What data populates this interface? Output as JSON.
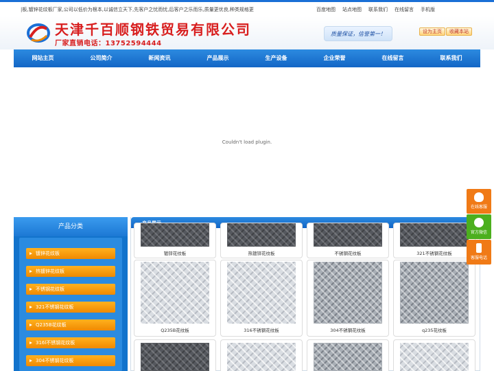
{
  "topbar": {
    "marquee": "|板,镀锌花纹板厂家,公司以低价为根本,以诚信立天下,先客户之忧而忧,后客户之乐而乐,质量更优良,种类规格更齐全,服务更周到",
    "links": [
      "百度地图",
      "站点地图",
      "联系我们",
      "在线留言",
      "手机版"
    ]
  },
  "header": {
    "company": "天津千百顺钢铁贸易有限公司",
    "hotline": "厂家直销电话：13752594444",
    "slogan": "质量保证，信誉第一！",
    "set_home": "设为主页",
    "bookmark": "收藏本站",
    "logo_colors": [
      "#1a6fd6",
      "#d81e1e",
      "#f08900"
    ]
  },
  "nav": [
    "网站主页",
    "公司简介",
    "新闻资讯",
    "产品展示",
    "生产设备",
    "企业荣誉",
    "在线留言",
    "联系我们"
  ],
  "banner": {
    "message": "Couldn't load plugin."
  },
  "sidebar": {
    "title": "产品分类",
    "categories": [
      "镀锌花纹板",
      "热镀锌花纹板",
      "不锈钢花纹板",
      "321不锈钢花纹板",
      "Q235B花纹板",
      "316l不锈钢花纹板",
      "304不锈钢花纹板"
    ]
  },
  "products": {
    "title": "产品展示",
    "items": [
      {
        "name": "镀锌花纹板",
        "texture": "dark"
      },
      {
        "name": "热镀锌花纹板",
        "texture": "dark"
      },
      {
        "name": "不锈钢花纹板",
        "texture": "dark"
      },
      {
        "name": "321不锈钢花纹板",
        "texture": "dark"
      },
      {
        "name": "Q235B花纹板",
        "texture": "light"
      },
      {
        "name": "316不锈钢花纹板",
        "texture": "light"
      },
      {
        "name": "304不锈钢花纹板",
        "texture": "mid"
      },
      {
        "name": "q235花纹板",
        "texture": "mid"
      },
      {
        "name": "",
        "texture": "dark"
      },
      {
        "name": "",
        "texture": "light"
      },
      {
        "name": "",
        "texture": "mid"
      },
      {
        "name": "",
        "texture": "light"
      }
    ]
  },
  "float_service": {
    "qq": "在线客服",
    "wechat": "官方微信",
    "phone": "客服电话"
  },
  "colors": {
    "brand_blue": "#1a6fd6",
    "brand_red": "#d81e1e",
    "accent_orange": "#f08900",
    "wechat_green": "#4caf1e"
  },
  "icons": [
    "qq-icon",
    "wechat-icon",
    "phone-icon",
    "logo-icon"
  ]
}
